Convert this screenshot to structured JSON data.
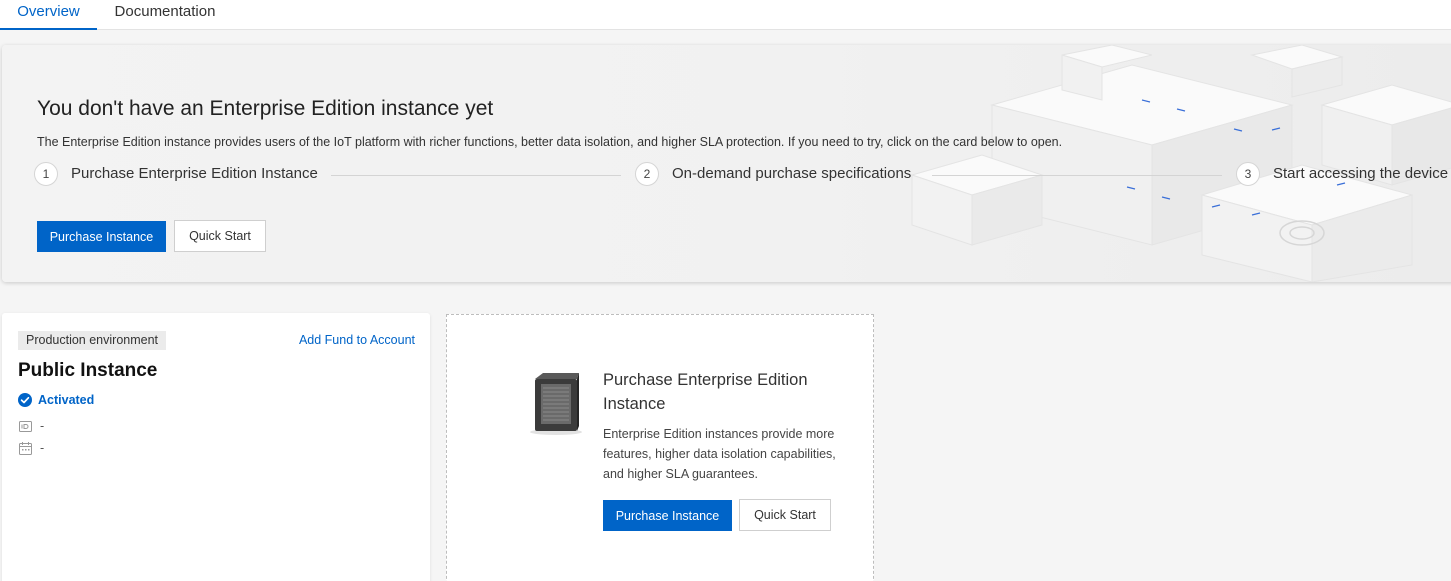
{
  "tabs": [
    {
      "label": "Overview",
      "active": true
    },
    {
      "label": "Documentation",
      "active": false
    }
  ],
  "banner": {
    "title": "You don't have an Enterprise Edition instance yet",
    "description": "The Enterprise Edition instance provides users of the IoT platform with richer functions, better data isolation, and higher SLA protection. If you need to try, click on the card below to open.",
    "steps": [
      {
        "num": "1",
        "label": "Purchase Enterprise Edition Instance"
      },
      {
        "num": "2",
        "label": "On-demand purchase specifications"
      },
      {
        "num": "3",
        "label": "Start accessing the device"
      }
    ],
    "purchase_label": "Purchase Instance",
    "quickstart_label": "Quick Start"
  },
  "public_instance": {
    "env_tag": "Production environment",
    "fund_link": "Add Fund to Account",
    "title": "Public Instance",
    "status": "Activated",
    "id_value": "-",
    "date_value": "-"
  },
  "purchase_card": {
    "title": "Purchase Enterprise Edition Instance",
    "description": "Enterprise Edition instances provide more features, higher data isolation capabilities, and higher SLA guarantees.",
    "purchase_label": "Purchase Instance",
    "quickstart_label": "Quick Start"
  },
  "colors": {
    "primary": "#0064c8",
    "page_bg": "#f5f5f5"
  }
}
